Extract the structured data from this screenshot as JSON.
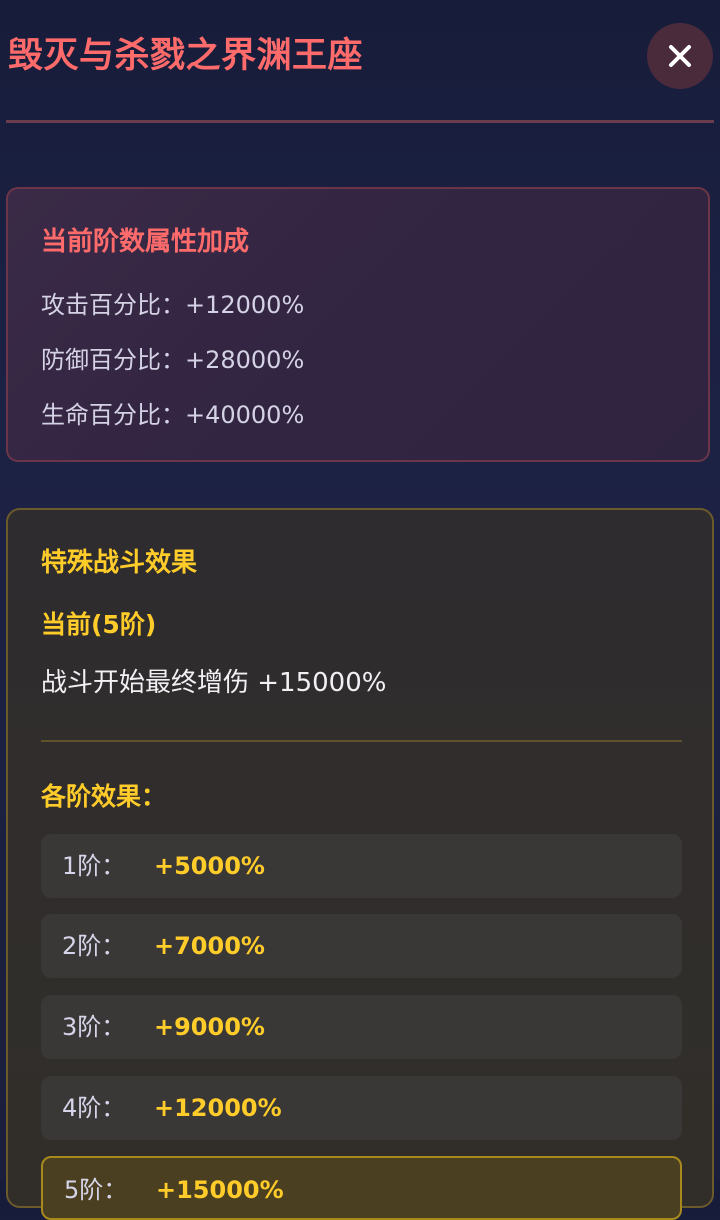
{
  "header": {
    "title": "毁灭与杀戮之界渊王座",
    "close_icon": "close-icon"
  },
  "attributes": {
    "title": "当前阶数属性加成",
    "lines": [
      "攻击百分比：+12000%",
      "防御百分比：+28000%",
      "生命百分比：+40000%"
    ]
  },
  "special": {
    "title": "特殊战斗效果",
    "current_label": "当前(5阶)",
    "current_desc": "战斗开始最终增伤 +15000%",
    "tiers_title": "各阶效果：",
    "tiers": [
      {
        "label": "1阶：",
        "value": "+5000%"
      },
      {
        "label": "2阶：",
        "value": "+7000%"
      },
      {
        "label": "3阶：",
        "value": "+9000%"
      },
      {
        "label": "4阶：",
        "value": "+12000%"
      },
      {
        "label": "5阶：",
        "value": "+15000%"
      }
    ],
    "active_tier_index": 4
  },
  "colors": {
    "title_red": "#ff6b6b",
    "gold": "#ffcc2a"
  }
}
